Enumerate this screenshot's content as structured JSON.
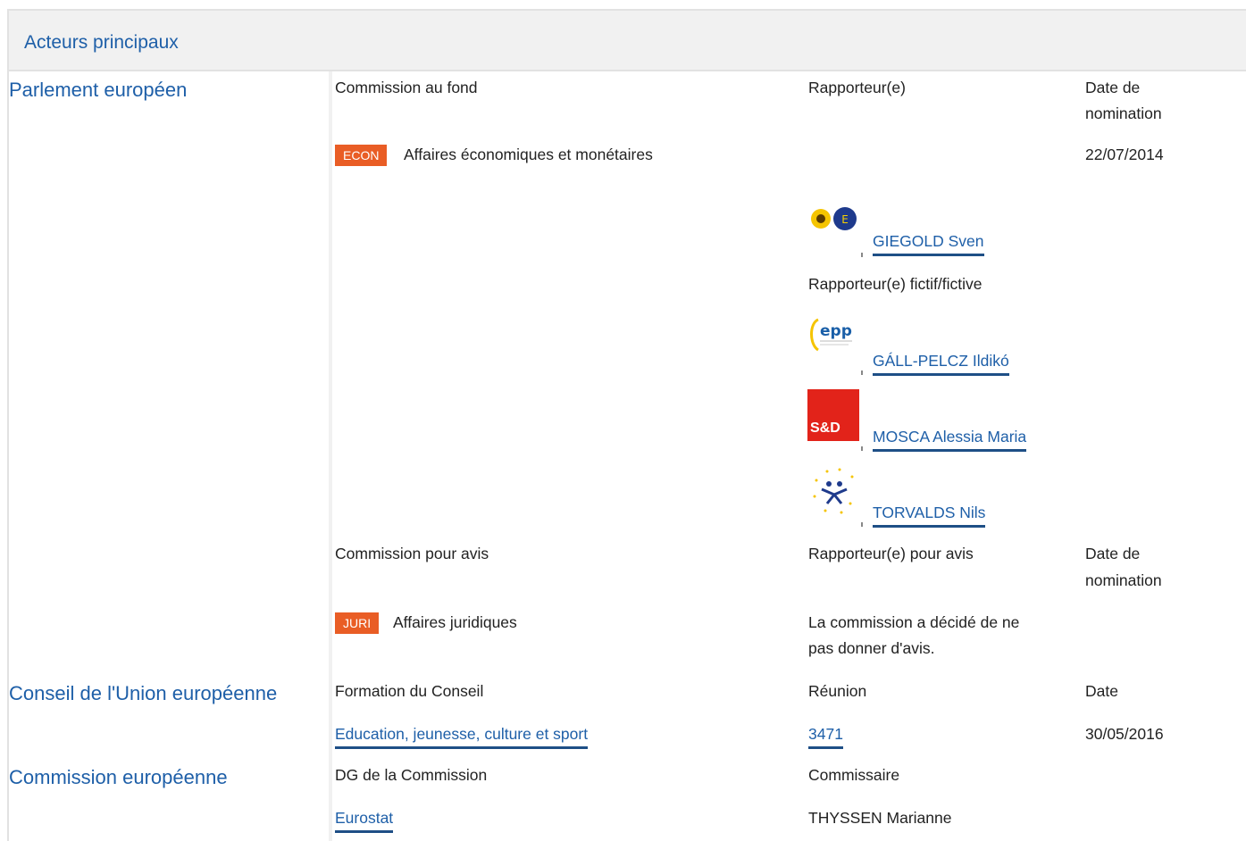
{
  "header": {
    "title": "Acteurs principaux"
  },
  "parliament": {
    "label": "Parlement européen",
    "lead": {
      "col_committee": "Commission au fond",
      "col_rapporteur": "Rapporteur(e)",
      "col_date_line1": "Date de",
      "col_date_line2": "nomination",
      "committee_code": "ECON",
      "committee_name": "Affaires économiques et monétaires",
      "date": "22/07/2014",
      "rapporteur": {
        "name": "GIEGOLD Sven",
        "group_icon": "greens-efa-logo"
      },
      "shadow_label": "Rapporteur(e) fictif/fictive",
      "shadows": [
        {
          "name": "GÁLL-PELCZ Ildikó",
          "group_icon": "epp-logo"
        },
        {
          "name": "MOSCA Alessia Maria",
          "group_icon": "sd-logo",
          "logo_text": "S&D"
        },
        {
          "name": "TORVALDS Nils",
          "group_icon": "alde-logo"
        }
      ]
    },
    "opinion": {
      "col_committee": "Commission pour avis",
      "col_rapporteur": "Rapporteur(e) pour avis",
      "col_date_line1": "Date de",
      "col_date_line2": "nomination",
      "committee_code": "JURI",
      "committee_name": "Affaires juridiques",
      "note_line1": "La commission a décidé de ne",
      "note_line2": "pas donner d'avis."
    }
  },
  "council": {
    "label": "Conseil de l'Union européenne",
    "col_formation": "Formation du Conseil",
    "col_meeting": "Réunion",
    "col_date": "Date",
    "formation": "Education, jeunesse, culture et sport",
    "meeting": "3471",
    "date": "30/05/2016"
  },
  "commission": {
    "label": "Commission européenne",
    "col_dg": "DG de la Commission",
    "col_commissioner": "Commissaire",
    "dg": "Eurostat",
    "commissioner": "THYSSEN Marianne"
  },
  "colors": {
    "link": "#1e5fa8",
    "badge": "#e95d25",
    "header_bg": "#f1f1f1"
  }
}
